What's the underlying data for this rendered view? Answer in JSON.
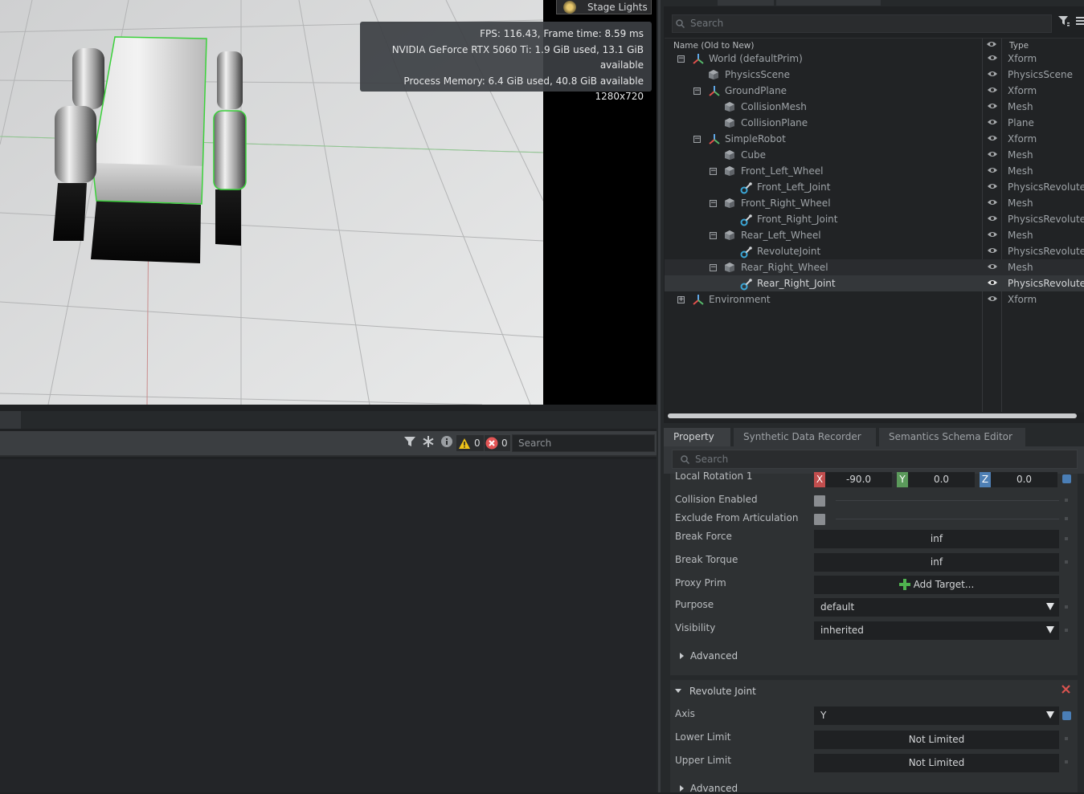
{
  "viewport": {
    "stage_lights_label": "Stage Lights",
    "stats": {
      "fps": "FPS: 116.43, Frame time: 8.59 ms",
      "gpu": "NVIDIA GeForce RTX 5060 Ti: 1.9 GiB used, 13.1 GiB available",
      "memory": "Process Memory: 6.4 GiB used, 40.8 GiB available",
      "resolution": "1280x720"
    }
  },
  "console": {
    "warning_count": "0",
    "error_count": "0",
    "search_placeholder": "Search"
  },
  "stage": {
    "search_placeholder": "Search",
    "columns": {
      "name": "Name (Old to New)",
      "type": "Type"
    },
    "rows": [
      {
        "name": "World (defaultPrim)",
        "type": "Xform",
        "icon": "xform-icon",
        "expander": "minus",
        "indent": 0
      },
      {
        "name": "PhysicsScene",
        "type": "PhysicsScene",
        "icon": "prim-icon",
        "expander": "none",
        "indent": 1
      },
      {
        "name": "GroundPlane",
        "type": "Xform",
        "icon": "xform-icon",
        "expander": "minus",
        "indent": 1
      },
      {
        "name": "CollisionMesh",
        "type": "Mesh",
        "icon": "prim-icon",
        "expander": "none",
        "indent": 2
      },
      {
        "name": "CollisionPlane",
        "type": "Plane",
        "icon": "prim-icon",
        "expander": "none",
        "indent": 2
      },
      {
        "name": "SimpleRobot",
        "type": "Xform",
        "icon": "xform-icon",
        "expander": "minus",
        "indent": 1
      },
      {
        "name": "Cube",
        "type": "Mesh",
        "icon": "prim-icon",
        "expander": "none",
        "indent": 2
      },
      {
        "name": "Front_Left_Wheel",
        "type": "Mesh",
        "icon": "prim-icon",
        "expander": "minus",
        "indent": 2
      },
      {
        "name": "Front_Left_Joint",
        "type": "PhysicsRevolute",
        "icon": "joint-icon",
        "expander": "none",
        "indent": 3
      },
      {
        "name": "Front_Right_Wheel",
        "type": "Mesh",
        "icon": "prim-icon",
        "expander": "minus",
        "indent": 2
      },
      {
        "name": "Front_Right_Joint",
        "type": "PhysicsRevolute",
        "icon": "joint-icon",
        "expander": "none",
        "indent": 3
      },
      {
        "name": "Rear_Left_Wheel",
        "type": "Mesh",
        "icon": "prim-icon",
        "expander": "minus",
        "indent": 2
      },
      {
        "name": "RevoluteJoint",
        "type": "PhysicsRevolute",
        "icon": "joint-icon",
        "expander": "none",
        "indent": 3
      },
      {
        "name": "Rear_Right_Wheel",
        "type": "Mesh",
        "icon": "prim-icon",
        "expander": "minus",
        "indent": 2,
        "state": "hover"
      },
      {
        "name": "Rear_Right_Joint",
        "type": "PhysicsRevolute",
        "icon": "joint-icon",
        "expander": "none",
        "indent": 3,
        "state": "selected"
      },
      {
        "name": "Environment",
        "type": "Xform",
        "icon": "xform-icon",
        "expander": "plus",
        "indent": 0
      }
    ]
  },
  "property": {
    "tabs": [
      "Property",
      "Synthetic Data Recorder",
      "Semantics Schema Editor"
    ],
    "search_placeholder": "Search",
    "local_rotation": {
      "label": "Local Rotation 1",
      "x": "-90.0",
      "y": "0.0",
      "z": "0.0",
      "x_label": "X",
      "y_label": "Y",
      "z_label": "Z"
    },
    "collision_enabled": "Collision Enabled",
    "exclude_articulation": "Exclude From Articulation",
    "break_force": {
      "label": "Break Force",
      "value": "inf"
    },
    "break_torque": {
      "label": "Break Torque",
      "value": "inf"
    },
    "proxy_prim": {
      "label": "Proxy Prim",
      "button": "Add Target..."
    },
    "purpose": {
      "label": "Purpose",
      "value": "default"
    },
    "visibility": {
      "label": "Visibility",
      "value": "inherited"
    },
    "advanced_label": "Advanced",
    "revolute": {
      "title": "Revolute Joint",
      "axis": {
        "label": "Axis",
        "value": "Y"
      },
      "lower_limit": {
        "label": "Lower Limit",
        "value": "Not Limited"
      },
      "upper_limit": {
        "label": "Upper Limit",
        "value": "Not Limited"
      },
      "advanced_label": "Advanced"
    }
  },
  "colors": {
    "axis_x": "#c24e4e",
    "axis_y": "#5b9a5b",
    "axis_z": "#4e7fb4",
    "selection_green": "#3bd13b",
    "joint_icon": "#3aa6d6"
  }
}
